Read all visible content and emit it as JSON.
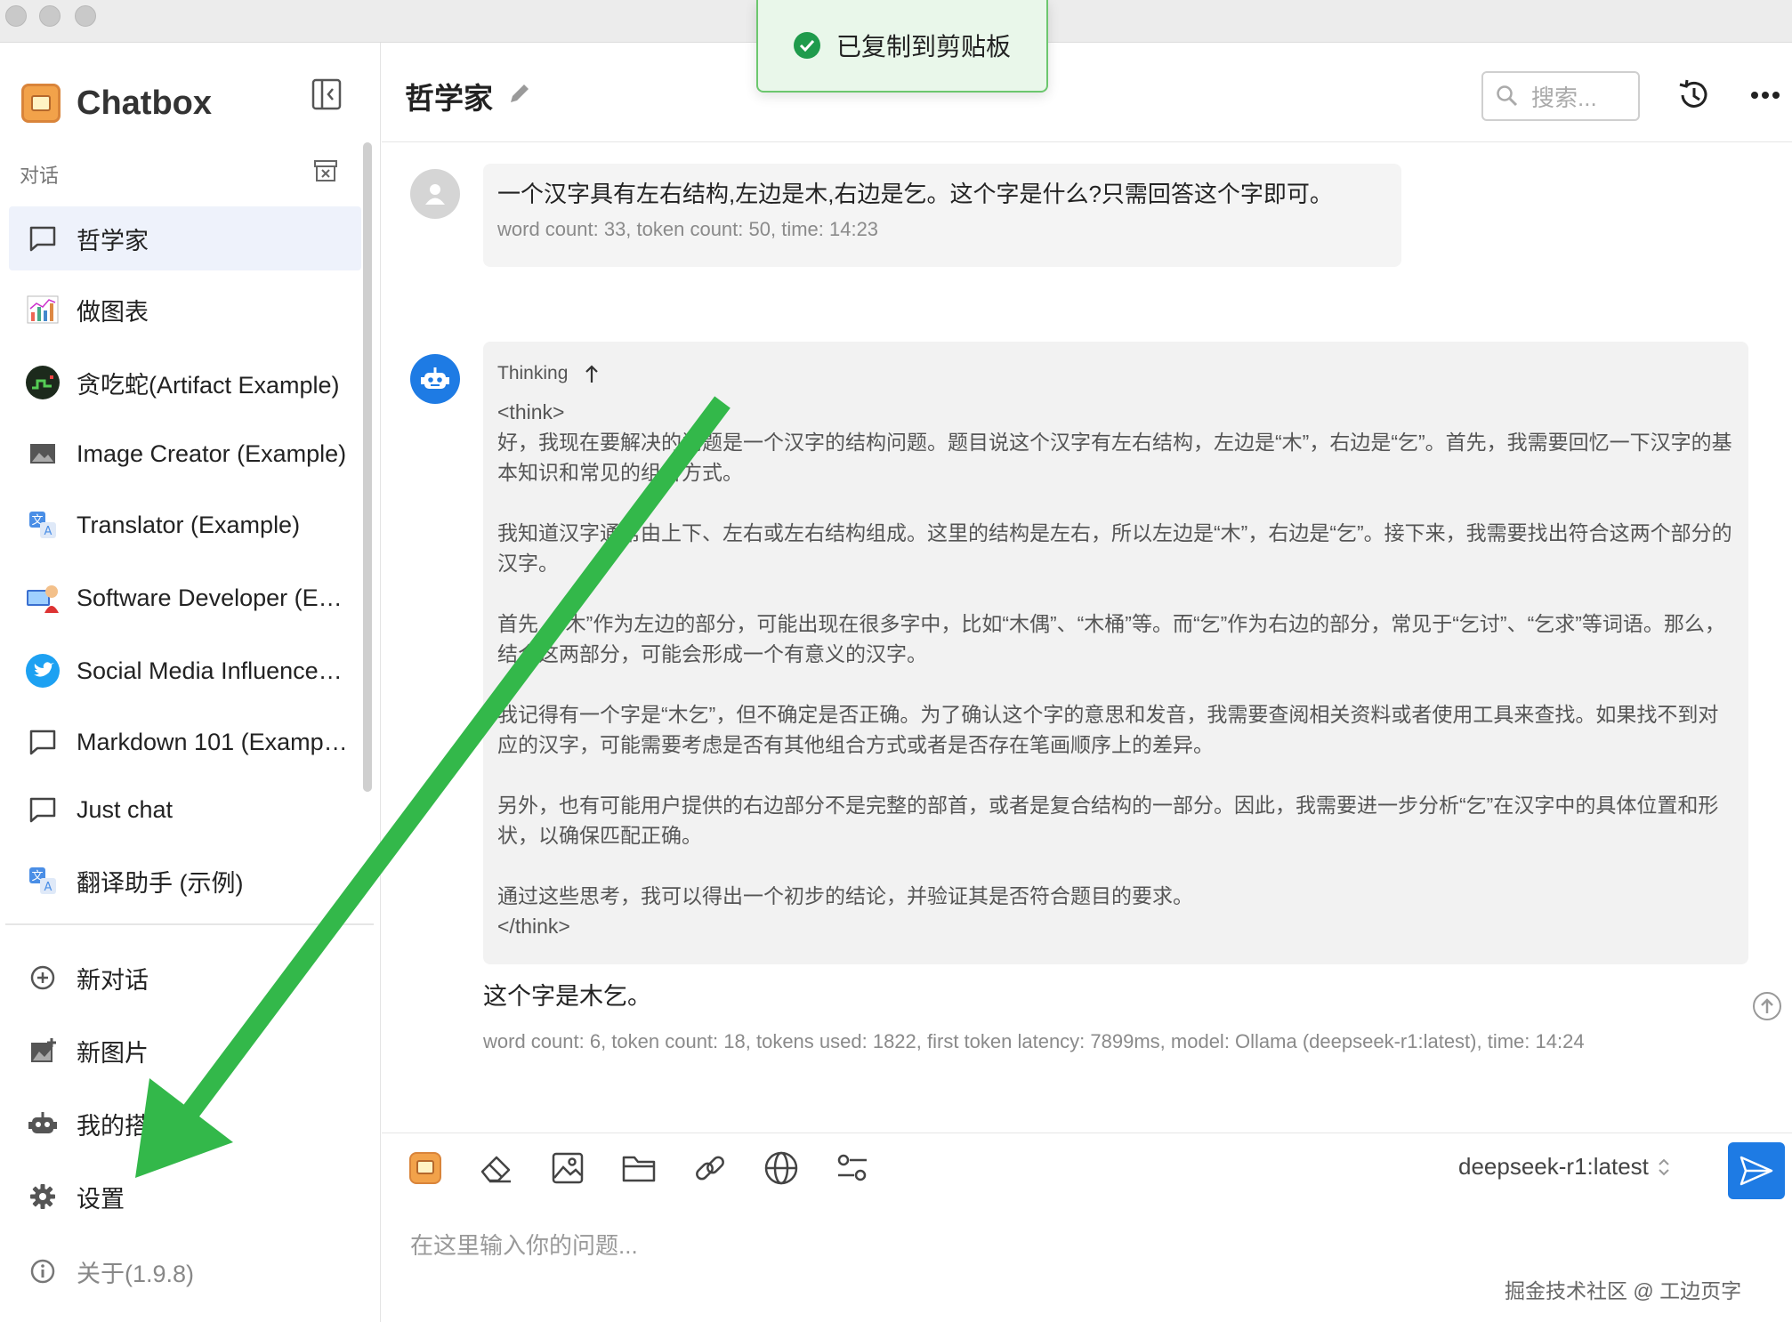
{
  "app": {
    "name": "Chatbox"
  },
  "toast": {
    "text": "已复制到剪贴板"
  },
  "sidebar": {
    "section_label": "对话",
    "conversations": [
      {
        "label": "哲学家",
        "icon": "chat-bubble-icon",
        "active": true
      },
      {
        "label": "做图表",
        "icon": "chart-icon"
      },
      {
        "label": "贪吃蛇(Artifact Example)",
        "icon": "snake-game-icon"
      },
      {
        "label": "Image Creator (Example)",
        "icon": "image-icon"
      },
      {
        "label": "Translator (Example)",
        "icon": "translate-icon"
      },
      {
        "label": "Software Developer (E…",
        "icon": "developer-avatar-icon"
      },
      {
        "label": "Social Media Influence…",
        "icon": "twitter-bird-icon"
      },
      {
        "label": "Markdown 101 (Examp…",
        "icon": "chat-bubble-icon"
      },
      {
        "label": "Just chat",
        "icon": "chat-bubble-icon"
      },
      {
        "label": "翻译助手 (示例)",
        "icon": "translate-icon"
      }
    ],
    "menu": [
      {
        "label": "新对话",
        "icon": "plus-circle-icon"
      },
      {
        "label": "新图片",
        "icon": "add-image-icon"
      },
      {
        "label": "我的搭档",
        "icon": "robot-icon"
      },
      {
        "label": "设置",
        "icon": "gear-icon"
      },
      {
        "label": "关于(1.9.8)",
        "icon": "info-icon"
      }
    ]
  },
  "header": {
    "title": "哲学家",
    "search_placeholder": "搜索..."
  },
  "messages": {
    "user": {
      "text": "一个汉字具有左右结构,左边是木,右边是乞。这个字是什么?只需回答这个字即可。",
      "meta": "word count: 33, token count: 50, time: 14:23"
    },
    "assistant": {
      "thinking_label": "Thinking",
      "think_open": "<think>",
      "paragraphs": [
        "好，我现在要解决的问题是一个汉字的结构问题。题目说这个汉字有左右结构，左边是“木”，右边是“乞”。首先，我需要回忆一下汉字的基本知识和常见的组合方式。",
        "我知道汉字通常由上下、左右或左右结构组成。这里的结构是左右，所以左边是“木”，右边是“乞”。接下来，我需要找出符合这两个部分的汉字。",
        "首先，“木”作为左边的部分，可能出现在很多字中，比如“木偶”、“木桶”等。而“乞”作为右边的部分，常见于“乞讨”、“乞求”等词语。那么，结合这两部分，可能会形成一个有意义的汉字。",
        "我记得有一个字是“木乞”，但不确定是否正确。为了确认这个字的意思和发音，我需要查阅相关资料或者使用工具来查找。如果找不到对应的汉字，可能需要考虑是否有其他组合方式或者是否存在笔画顺序上的差异。",
        "另外，也有可能用户提供的右边部分不是完整的部首，或者是复合结构的一部分。因此，我需要进一步分析“乞”在汉字中的具体位置和形状，以确保匹配正确。",
        "通过这些思考，我可以得出一个初步的结论，并验证其是否符合题目的要求。"
      ],
      "think_close": "</think>",
      "answer": "这个字是木乞。",
      "meta": "word count: 6, token count: 18, tokens used: 1822, first token latency: 7899ms, model: Ollama (deepseek-r1:latest), time: 14:24"
    }
  },
  "composer": {
    "model": "deepseek-r1:latest",
    "placeholder": "在这里输入你的问题...",
    "watermark": "掘金技术社区 @ 工边页字",
    "tools": [
      "chatbox-logo-icon",
      "eraser-icon",
      "image-icon",
      "folder-icon",
      "link-icon",
      "globe-icon",
      "settings-sliders-icon"
    ]
  },
  "colors": {
    "accent": "#1e7be4",
    "toast_bg": "#e9f7ea",
    "arrow": "#33b84a"
  }
}
